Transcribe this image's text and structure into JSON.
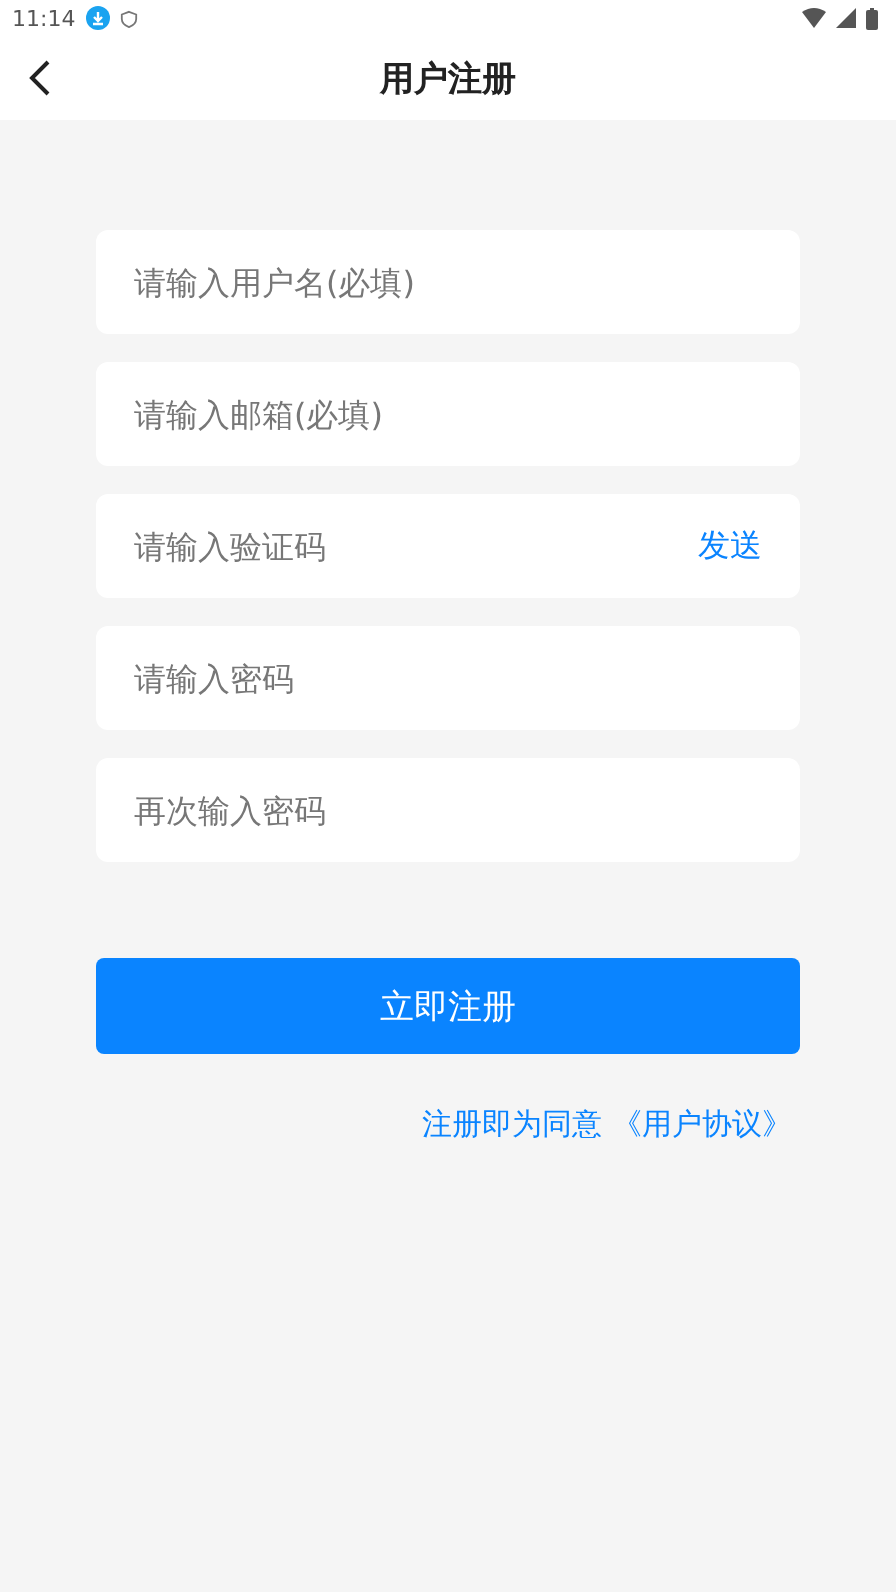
{
  "status_bar": {
    "time": "11:14"
  },
  "header": {
    "title": "用户注册"
  },
  "fields": [
    {
      "kind": "input",
      "placeholder": "请输入用户名(必填)"
    },
    {
      "kind": "input",
      "placeholder": "请输入邮箱(必填)"
    },
    {
      "kind": "code",
      "placeholder": "请输入验证码",
      "action": "发送"
    },
    {
      "kind": "input",
      "placeholder": "请输入密码"
    },
    {
      "kind": "input",
      "placeholder": "再次输入密码"
    }
  ],
  "submit": "立即注册",
  "agreement": {
    "text": "注册即为同意 ",
    "link": "《用户协议》"
  }
}
